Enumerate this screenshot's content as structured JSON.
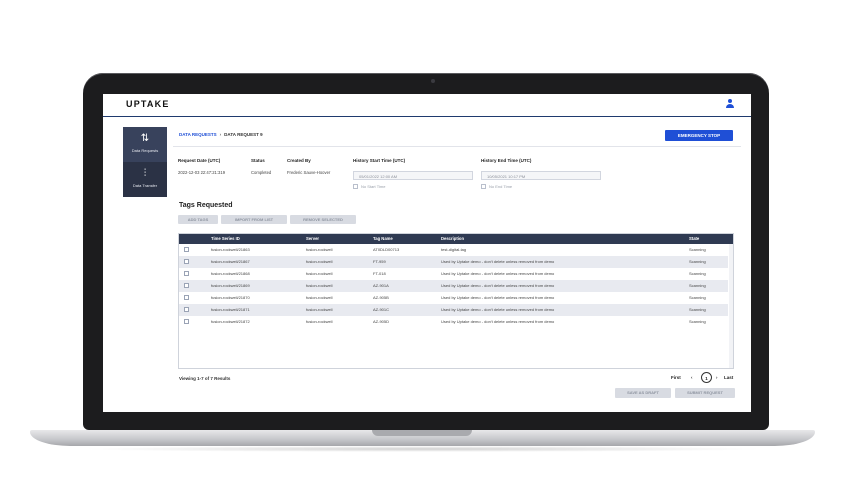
{
  "app": {
    "logo": "UPTAKE"
  },
  "sidebar": {
    "items": [
      {
        "label": "Data Requests",
        "icon": "sort-arrows-icon"
      },
      {
        "label": "Data Transfer",
        "icon": "transfer-chart-icon"
      }
    ]
  },
  "breadcrumb": {
    "root": "DATA REQUESTS",
    "separator": "›",
    "current": "DATA REQUEST 9"
  },
  "actions": {
    "emergency_stop": "EMERGENCY STOP"
  },
  "request": {
    "date_label": "Request Date (UTC)",
    "date_value": "2022-12-03 22:47:21:319",
    "status_label": "Status",
    "status_value": "Completed",
    "created_label": "Created By",
    "created_value": "Frederic Sauve-Hoover",
    "history_start_label": "History Start Time (UTC)",
    "history_start_value": "05/01/2022 12:00 AM",
    "no_start_label": "No Start Time",
    "history_end_label": "History End Time (UTC)",
    "history_end_value": "10/05/2021 10:17 PM",
    "no_end_label": "No End Time"
  },
  "tags": {
    "title": "Tags Requested",
    "buttons": {
      "add": "ADD TAGS",
      "import": "IMPORT FROM LIST",
      "remove": "REMOVE SELECTED"
    },
    "columns": [
      "Time Series ID",
      "Server",
      "Tag Name",
      "Description",
      "State"
    ],
    "rows": [
      {
        "id": "fusion-rockwell/21863",
        "server": "fusion-rockwell",
        "tag": "AT0DLD00713",
        "desc": "test-digital-tag",
        "state": "Scanning"
      },
      {
        "id": "fusion-rockwell/21867",
        "server": "fusion-rockwell",
        "tag": "FT-959",
        "desc": "Used by Uptake demo - don't delete unless removed from demo",
        "state": "Scanning"
      },
      {
        "id": "fusion-rockwell/21868",
        "server": "fusion-rockwell",
        "tag": "FT-018",
        "desc": "Used by Uptake demo - don't delete unless removed from demo",
        "state": "Scanning"
      },
      {
        "id": "fusion-rockwell/21869",
        "server": "fusion-rockwell",
        "tag": "AZ-901A",
        "desc": "Used by Uptake demo - don't delete unless removed from demo",
        "state": "Scanning"
      },
      {
        "id": "fusion-rockwell/21870",
        "server": "fusion-rockwell",
        "tag": "AZ-905B",
        "desc": "Used by Uptake demo - don't delete unless removed from demo",
        "state": "Scanning"
      },
      {
        "id": "fusion-rockwell/21871",
        "server": "fusion-rockwell",
        "tag": "AZ-901C",
        "desc": "Used by Uptake demo - don't delete unless removed from demo",
        "state": "Scanning"
      },
      {
        "id": "fusion-rockwell/21872",
        "server": "fusion-rockwell",
        "tag": "AZ-905D",
        "desc": "Used by Uptake demo - don't delete unless removed from demo",
        "state": "Scanning"
      }
    ]
  },
  "footer": {
    "viewing": "Viewing 1-7 of 7 Results",
    "first": "First",
    "prev": "‹",
    "page": "1",
    "next": "›",
    "last": "Last",
    "save_draft": "SAVE AS DRAFT",
    "submit": "SUBMIT REQUEST"
  },
  "colors": {
    "accent": "#1f4fd6",
    "sidebar": "#2b3245",
    "table_header": "#2f3a52"
  }
}
